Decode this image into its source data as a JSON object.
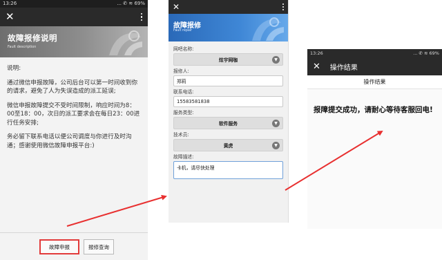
{
  "screen1": {
    "status_time": "13:26",
    "status_right": "... ✆ ≋ 69%",
    "banner_title": "故障报修说明",
    "banner_subtitle": "Fault description",
    "body": [
      "说明:",
      "通过微信申报故障，公司后台可以第一时间收到你的请求，避免了人为失误造成的派工延误;",
      "微信申报故障提交不受时间限制，响应时间为8：00至18：00，次日的派工要求会在每日23：00进行任务安排;",
      "务必留下联系电话以便公司调度与你进行及时沟通；感谢使用微信故障申报平台:)"
    ],
    "btn_report": "故障申报",
    "btn_query": "报修查询"
  },
  "screen2": {
    "banner_title": "故障报修",
    "banner_subtitle": "Fault repair",
    "fields": {
      "cafe_label": "网吧名称:",
      "cafe_value": "炫宇网咖",
      "reporter_label": "报修人:",
      "reporter_value": "郑莉",
      "phone_label": "联系电话:",
      "phone_value": "15583581838",
      "service_label": "服务类型:",
      "service_value": "软件服务",
      "tech_label": "技术员:",
      "tech_value": "黄虎",
      "desc_label": "故障描述:",
      "desc_value": "卡机，请尽快处理"
    }
  },
  "screen3": {
    "status_time": "13:26",
    "status_right": "... ✆ ≋ 69%",
    "nav_title": "操作结果",
    "header": "操作结果",
    "message": "报障提交成功，请耐心等待客服回电!"
  },
  "colors": {
    "arrow": "#e83030",
    "highlight": "#e23a3a",
    "blue_banner": "#3f87d6",
    "dark_bar": "#2a2a2a"
  }
}
